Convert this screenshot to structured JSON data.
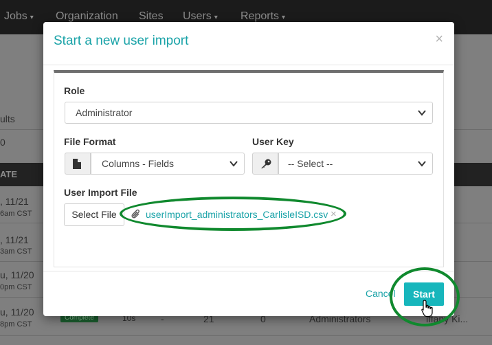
{
  "nav": {
    "items": [
      {
        "label": "Jobs",
        "caret": "▾"
      },
      {
        "label": "Organization",
        "caret": ""
      },
      {
        "label": "Sites",
        "caret": ""
      },
      {
        "label": "Users",
        "caret": "▾"
      },
      {
        "label": "Reports",
        "caret": "▾"
      }
    ]
  },
  "background": {
    "results_fragment": "ults",
    "count_fragment": "0",
    "date_header": "ATE",
    "rows": [
      {
        "date": ", 11/21",
        "time": "6am CST"
      },
      {
        "date": ", 11/21",
        "time": "3am CST"
      },
      {
        "date": "u, 11/20",
        "time": "0pm CST"
      },
      {
        "date": "u, 11/20",
        "time": "8pm CST"
      }
    ],
    "status_badge": "Complete",
    "duration": "10s",
    "dash": "-",
    "count": "21",
    "zero": "0",
    "role_col": "Administrators",
    "user_col": "iffany Ki..."
  },
  "modal": {
    "title": "Start a new user import",
    "close": "×",
    "role": {
      "label": "Role",
      "value": "Administrator"
    },
    "file_format": {
      "label": "File Format",
      "value": "Columns - Fields"
    },
    "user_key": {
      "label": "User Key",
      "value": "-- Select --"
    },
    "import_file": {
      "label": "User Import File",
      "select_button": "Select File",
      "file_name": "userImport_administrators_CarlisleISD.csv",
      "remove": "×"
    },
    "cancel": "Cancel",
    "start": "Start"
  },
  "colors": {
    "accent": "#17b6bc",
    "title": "#1aa3a8",
    "annotation": "#10892e"
  }
}
